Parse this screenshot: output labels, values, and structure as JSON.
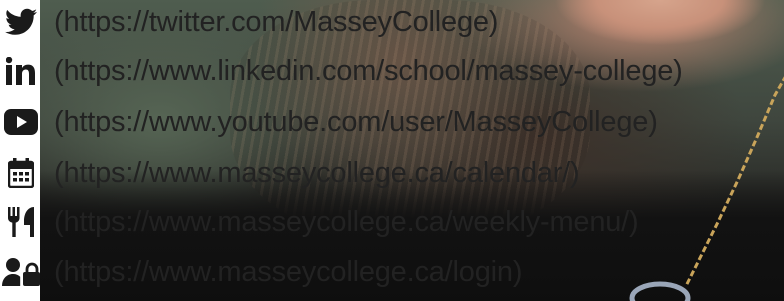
{
  "social_links": [
    {
      "icon": "twitter-icon",
      "text": "(https://twitter.com/MasseyCollege)"
    },
    {
      "icon": "linkedin-icon",
      "text": "(https://www.linkedin.com/school/massey-college)"
    },
    {
      "icon": "youtube-icon",
      "text": "(https://www.youtube.com/user/MasseyCollege)"
    },
    {
      "icon": "calendar-icon",
      "text": "(https://www.masseycollege.ca/calendar/)"
    },
    {
      "icon": "utensils-icon",
      "text": "(https://www.masseycollege.ca/weekly-menu/)"
    },
    {
      "icon": "user-lock-icon",
      "text": "(https://www.masseycollege.ca/login)"
    }
  ],
  "colors": {
    "icon": "#1a1a1a",
    "text": "#222222",
    "background": "#ffffff"
  }
}
